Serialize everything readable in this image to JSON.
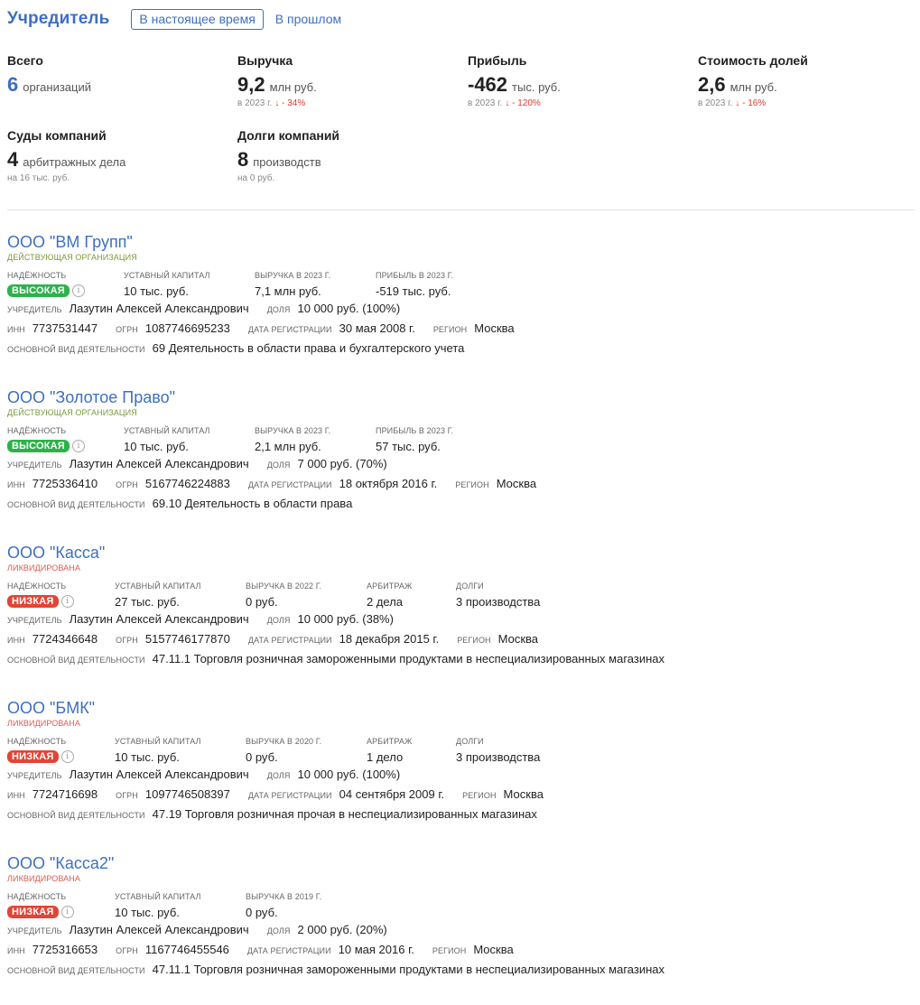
{
  "header": {
    "title": "Учредитель",
    "tab_active": "В настоящее время",
    "tab_past": "В прошлом"
  },
  "stats": {
    "total": {
      "label": "Всего",
      "value": "6",
      "unit": "организаций"
    },
    "revenue": {
      "label": "Выручка",
      "value": "9,2",
      "unit": "млн руб.",
      "year": "в 2023 г.",
      "change": "- 34%"
    },
    "profit": {
      "label": "Прибыль",
      "value": "-462",
      "unit": "тыс. руб.",
      "year": "в 2023 г.",
      "change": "- 120%"
    },
    "shares": {
      "label": "Стоимость долей",
      "value": "2,6",
      "unit": "млн руб.",
      "year": "в 2023 г.",
      "change": "- 16%"
    },
    "courts": {
      "label": "Суды компаний",
      "value": "4",
      "unit": "арбитражных дела",
      "sub": "на 16 тыс. руб."
    },
    "debts": {
      "label": "Долги компаний",
      "value": "8",
      "unit": "производств",
      "sub": "на 0 руб."
    }
  },
  "labels": {
    "reliability": "Надёжность",
    "capital": "Уставный капитал",
    "arbitration": "Арбитраж",
    "debts": "Долги",
    "founder": "Учредитель",
    "share": "Доля",
    "inn": "ИНН",
    "ogrn": "ОГРН",
    "reg_date": "Дата регистрации",
    "region": "Регион",
    "activity": "Основной вид деятельности"
  },
  "companies": [
    {
      "name": "ООО \"ВМ Групп\"",
      "status": "Действующая организация",
      "reliability": "Высокая",
      "capital": "10 тыс. руб.",
      "revenue_label": "Выручка в 2023 г.",
      "revenue": "7,1 млн руб.",
      "profit_label": "Прибыль в 2023 г.",
      "profit": "-519 тыс. руб.",
      "founder": "Лазутин Алексей Александрович",
      "share": "10 000 руб. (100%)",
      "inn": "7737531447",
      "ogrn": "1087746695233",
      "reg_date": "30 мая 2008 г.",
      "region": "Москва",
      "activity": "69 Деятельность в области права и бухгалтерского учета"
    },
    {
      "name": "ООО \"Золотое Право\"",
      "status": "Действующая организация",
      "reliability": "Высокая",
      "capital": "10 тыс. руб.",
      "revenue_label": "Выручка в 2023 г.",
      "revenue": "2,1 млн руб.",
      "profit_label": "Прибыль в 2023 г.",
      "profit": "57 тыс. руб.",
      "founder": "Лазутин Алексей Александрович",
      "share": "7 000 руб. (70%)",
      "inn": "7725336410",
      "ogrn": "5167746224883",
      "reg_date": "18 октября 2016 г.",
      "region": "Москва",
      "activity": "69.10 Деятельность в области права"
    },
    {
      "name": "ООО \"Касса\"",
      "status": "Ликвидирована",
      "reliability": "Низкая",
      "capital": "27 тыс. руб.",
      "revenue_label": "Выручка в 2022 г.",
      "revenue": "0 руб.",
      "arbitration": "2 дела",
      "debts": "3 производства",
      "founder": "Лазутин Алексей Александрович",
      "share": "10 000 руб. (38%)",
      "inn": "7724346648",
      "ogrn": "5157746177870",
      "reg_date": "18 декабря 2015 г.",
      "region": "Москва",
      "activity": "47.11.1 Торговля розничная замороженными продуктами в неспециализированных магазинах"
    },
    {
      "name": "ООО \"БМК\"",
      "status": "Ликвидирована",
      "reliability": "Низкая",
      "capital": "10 тыс. руб.",
      "revenue_label": "Выручка в 2020 г.",
      "revenue": "0 руб.",
      "arbitration": "1 дело",
      "debts": "3 производства",
      "founder": "Лазутин Алексей Александрович",
      "share": "10 000 руб. (100%)",
      "inn": "7724716698",
      "ogrn": "1097746508397",
      "reg_date": "04 сентября 2009 г.",
      "region": "Москва",
      "activity": "47.19 Торговля розничная прочая в неспециализированных магазинах"
    },
    {
      "name": "ООО \"Касса2\"",
      "status": "Ликвидирована",
      "reliability": "Низкая",
      "capital": "10 тыс. руб.",
      "revenue_label": "Выручка в 2019 г.",
      "revenue": "0 руб.",
      "founder": "Лазутин Алексей Александрович",
      "share": "2 000 руб. (20%)",
      "inn": "7725316653",
      "ogrn": "1167746455546",
      "reg_date": "10 мая 2016 г.",
      "region": "Москва",
      "activity": "47.11.1 Торговля розничная замороженными продуктами в неспециализированных магазинах"
    }
  ]
}
